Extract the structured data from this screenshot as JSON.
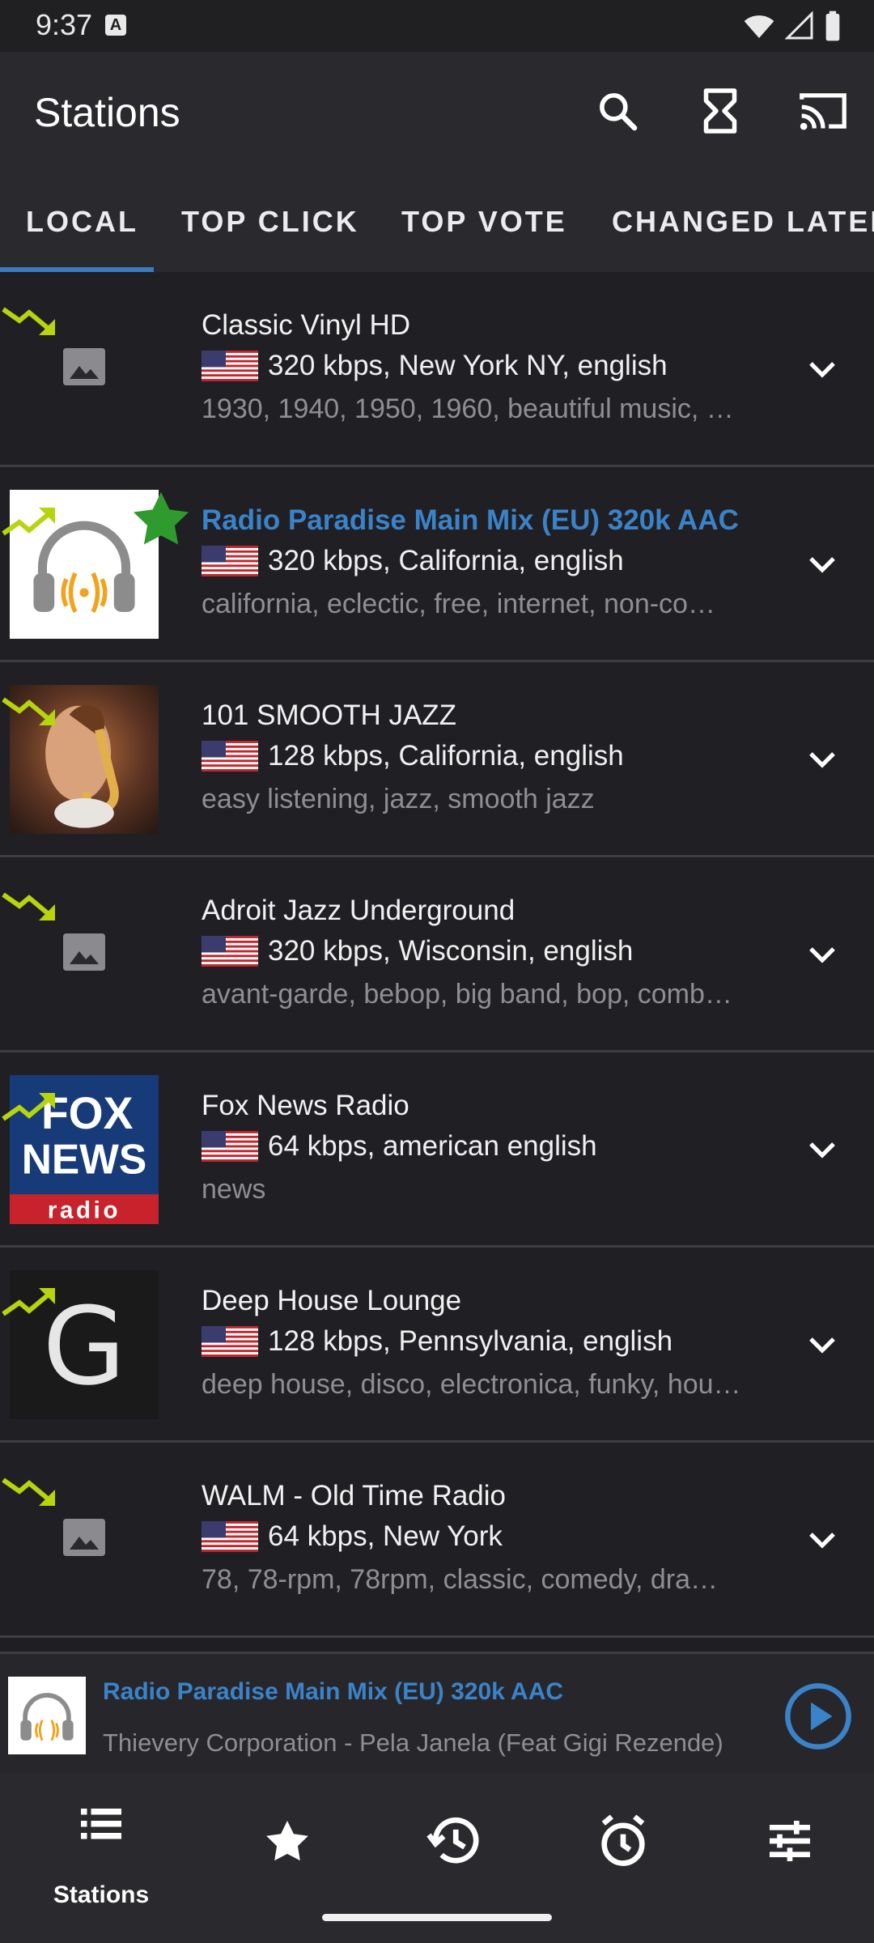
{
  "status_bar": {
    "time": "9:37",
    "notification_letter": "A"
  },
  "app_bar": {
    "title": "Stations",
    "actions": [
      "search-icon",
      "hourglass-icon",
      "cast-icon"
    ]
  },
  "tabs": [
    {
      "label": "LOCAL",
      "selected": true
    },
    {
      "label": "TOP CLICK",
      "selected": false
    },
    {
      "label": "TOP VOTE",
      "selected": false
    },
    {
      "label": "CHANGED LATEL",
      "selected": false
    }
  ],
  "stations": [
    {
      "name": "Classic Vinyl HD",
      "info": "320 kbps, New York NY, english",
      "tags": "1930, 1940, 1950, 1960, beautiful music, …",
      "trend": "down",
      "thumb": "placeholder",
      "favorite": false,
      "playing": false
    },
    {
      "name": "Radio Paradise Main Mix (EU) 320k AAC",
      "info": "320 kbps, California, english",
      "tags": "california, eclectic, free, internet, non-co…",
      "trend": "up",
      "thumb": "headphones",
      "favorite": true,
      "playing": true
    },
    {
      "name": "101 SMOOTH JAZZ",
      "info": "128 kbps, California, english",
      "tags": "easy listening, jazz, smooth jazz",
      "trend": "down",
      "thumb": "sax",
      "favorite": false,
      "playing": false
    },
    {
      "name": "Adroit Jazz Underground",
      "info": "320 kbps, Wisconsin, english",
      "tags": "avant-garde, bebop, big band, bop, comb…",
      "trend": "down",
      "thumb": "placeholder",
      "favorite": false,
      "playing": false
    },
    {
      "name": "Fox News Radio",
      "info": "64 kbps, american english",
      "tags": "news",
      "trend": "up",
      "thumb": "fox",
      "logo_text": [
        "FOX",
        "NEWS",
        "radio"
      ],
      "favorite": false,
      "playing": false
    },
    {
      "name": "Deep House Lounge",
      "info": "128 kbps, Pennsylvania, english",
      "tags": "deep house, disco, electronica, funky, hou…",
      "trend": "up",
      "thumb": "letter",
      "logo_text": [
        "G"
      ],
      "favorite": false,
      "playing": false
    },
    {
      "name": "WALM - Old Time Radio",
      "info": "64 kbps, New York",
      "tags": "78, 78-rpm, 78rpm, classic, comedy, dra…",
      "trend": "down",
      "thumb": "placeholder",
      "favorite": false,
      "playing": false
    }
  ],
  "now_playing": {
    "title": "Radio Paradise Main Mix (EU) 320k AAC",
    "subtitle": "Thievery Corporation - Pela Janela (Feat Gigi Rezende)"
  },
  "bottom_nav": [
    {
      "icon": "list-icon",
      "label": "Stations",
      "selected": true
    },
    {
      "icon": "star-icon",
      "label": "",
      "selected": false
    },
    {
      "icon": "history-icon",
      "label": "",
      "selected": false
    },
    {
      "icon": "alarm-icon",
      "label": "",
      "selected": false
    },
    {
      "icon": "equalizer-icon",
      "label": "",
      "selected": false
    }
  ],
  "colors": {
    "accent": "#3b83c9",
    "trend": "#b8d40f",
    "background": "#202024",
    "bar": "#2a2a2e",
    "muted_text": "#8e8e93"
  }
}
